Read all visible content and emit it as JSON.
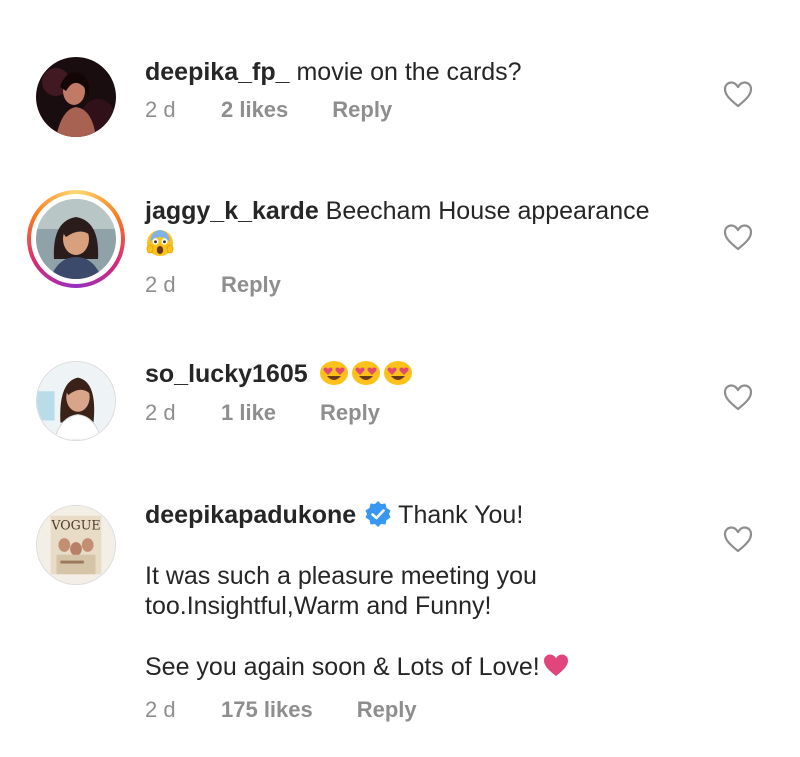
{
  "comments": [
    {
      "username": "deepika_fp_",
      "text": "movie on the cards?",
      "time": "2 d",
      "likes": "2 likes",
      "reply": "Reply",
      "avatar": "dark-photo-avatar"
    },
    {
      "username": "jaggy_k_karde",
      "text": "Beecham House appearance",
      "emoji": "screaming-face-emoji",
      "time": "2 d",
      "reply": "Reply",
      "avatar": "woman-photo-avatar",
      "story_ring": true
    },
    {
      "username": "so_lucky1605",
      "emojis": [
        "heart-eyes-emoji",
        "heart-eyes-emoji",
        "heart-eyes-emoji"
      ],
      "time": "2 d",
      "likes": "1 like",
      "reply": "Reply",
      "avatar": "woman-photo-avatar"
    },
    {
      "username": "deepikapadukone",
      "verified": true,
      "text_line1": "Thank You!",
      "text_line2": "It was such a pleasure meeting you",
      "text_line3": "too.Insightful,Warm and Funny!",
      "text_line4": "See you again soon & Lots of Love!",
      "time": "2 d",
      "likes": "175 likes",
      "reply": "Reply",
      "avatar": "vogue-cover-avatar",
      "avatar_logo": "VOGUE"
    }
  ],
  "colors": {
    "username": "#262626",
    "meta": "#8e8e8e",
    "verified_badge": "#3897f0",
    "pink_heart": "#e0457b",
    "heart_outline": "#8e8e8e"
  }
}
